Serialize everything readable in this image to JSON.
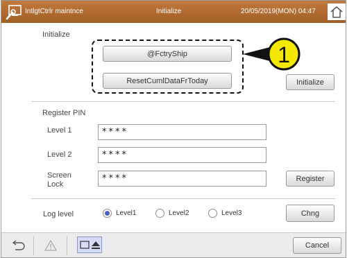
{
  "titlebar": {
    "app_name": "IntlgtCtrlr maintnce",
    "title": "Initialize",
    "datetime": "20/05/2019(MON) 04:47"
  },
  "initialize": {
    "section_label": "Initialize",
    "factory_ship_label": "@FctryShip",
    "reset_label": "ResetCumlDataFrToday",
    "initialize_label": "Initialize",
    "callout_number": "1"
  },
  "register_pin": {
    "section_label": "Register PIN",
    "rows": [
      {
        "label": "Level 1",
        "value": "****"
      },
      {
        "label": "Level 2",
        "value": "****"
      },
      {
        "label": "Screen",
        "label2": "Lock",
        "value": "****"
      }
    ],
    "register_label": "Register"
  },
  "log_level": {
    "label": "Log level",
    "options": [
      "Level1",
      "Level2",
      "Level3"
    ],
    "selected": "Level1",
    "change_label": "Chng"
  },
  "bottombar": {
    "cancel_label": "Cancel"
  },
  "colors": {
    "titlebar": "#a35e26",
    "callout": "#f5e800",
    "radio_selected": "#4a5fbf"
  }
}
